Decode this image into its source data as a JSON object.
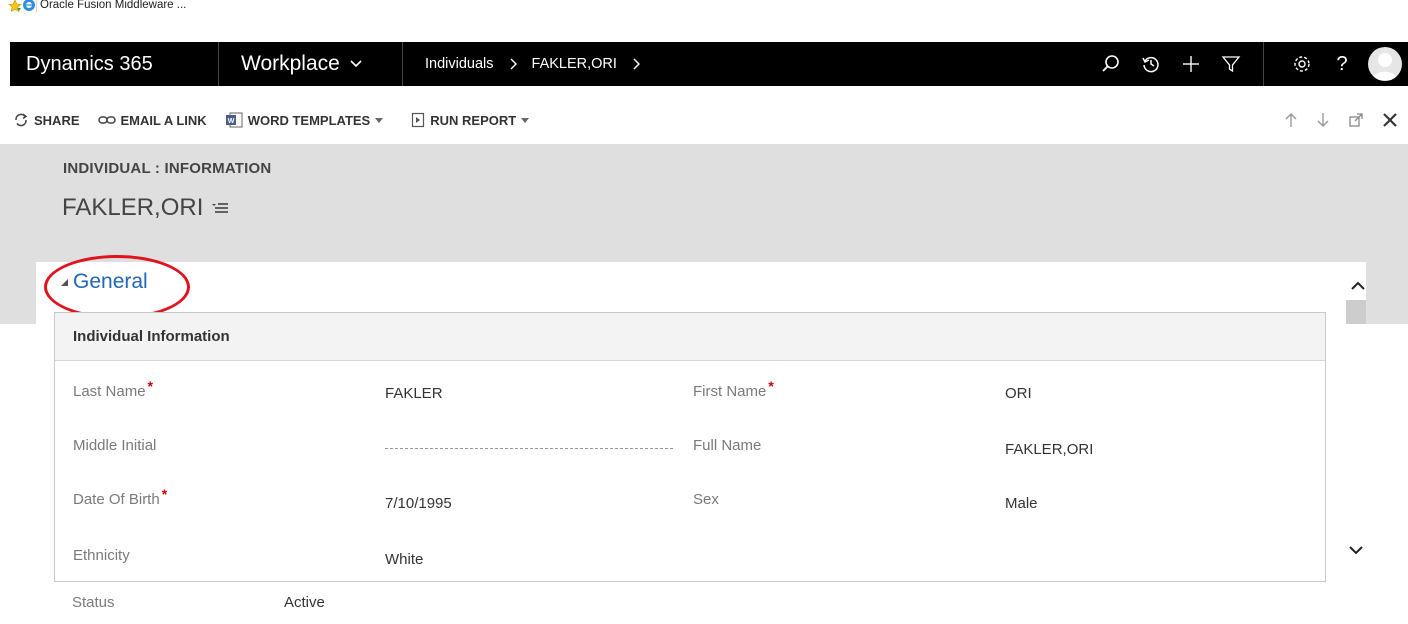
{
  "browser": {
    "favorite_label": "Oracle Fusion Middleware ..."
  },
  "nav": {
    "brand": "Dynamics 365",
    "area": "Workplace",
    "crumbs": [
      "Individuals",
      "FAKLER,ORI"
    ],
    "icons": [
      "search-icon",
      "recent-icon",
      "new-icon",
      "filter-icon",
      "settings-icon",
      "help-icon",
      "user-avatar"
    ],
    "help_label": "?"
  },
  "commands": {
    "share": "SHARE",
    "email_link": "EMAIL A LINK",
    "word_templates": "WORD TEMPLATES",
    "run_report": "RUN REPORT"
  },
  "header": {
    "entity_label": "INDIVIDUAL : INFORMATION",
    "record_title": "FAKLER,ORI"
  },
  "section": {
    "title": "General",
    "subsection_title": "Individual Information"
  },
  "fields": {
    "last_name": {
      "label": "Last Name",
      "value": "FAKLER",
      "required": true
    },
    "first_name": {
      "label": "First Name",
      "value": "ORI",
      "required": true
    },
    "middle_initial": {
      "label": "Middle Initial",
      "value": ""
    },
    "full_name": {
      "label": "Full Name",
      "value": "FAKLER,ORI"
    },
    "date_of_birth": {
      "label": "Date Of Birth",
      "value": "7/10/1995",
      "required": true
    },
    "sex": {
      "label": "Sex",
      "value": "Male"
    },
    "ethnicity": {
      "label": "Ethnicity",
      "value": "White"
    }
  },
  "footer": {
    "status_label": "Status",
    "status_value": "Active"
  },
  "colors": {
    "nav_bg": "#000000",
    "header_bg": "#dfdfdf",
    "section_title": "#2266b5",
    "required_mark": "#cc0000",
    "highlight_ring": "#e0141e"
  }
}
